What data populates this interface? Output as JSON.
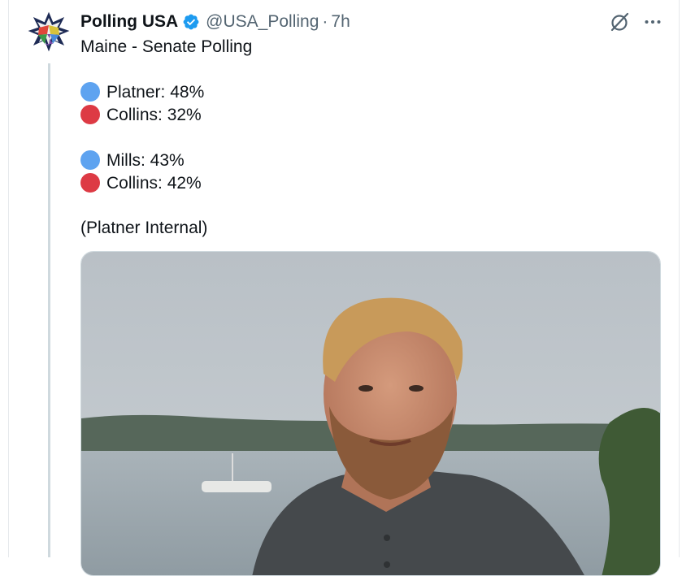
{
  "tweet": {
    "display_name": "Polling USA",
    "handle": "@USA_Polling",
    "separator": "·",
    "time": "7h",
    "text_title": "Maine - Senate Polling",
    "poll_group_1": [
      {
        "label": "Platner: 48%",
        "color": "#5ea3f0"
      },
      {
        "label": "Collins: 32%",
        "color": "#dd3a44"
      }
    ],
    "poll_group_2": [
      {
        "label": "Mills: 43%",
        "color": "#5ea3f0"
      },
      {
        "label": "Collins: 42%",
        "color": "#dd3a44"
      }
    ],
    "footnote": "(Platner Internal)"
  },
  "icons": {
    "verified": "verified-badge-icon",
    "grok": "grok-icon",
    "more": "more-icon"
  },
  "colors": {
    "verified_blue": "#1d9bf0",
    "secondary_text": "#536471"
  }
}
